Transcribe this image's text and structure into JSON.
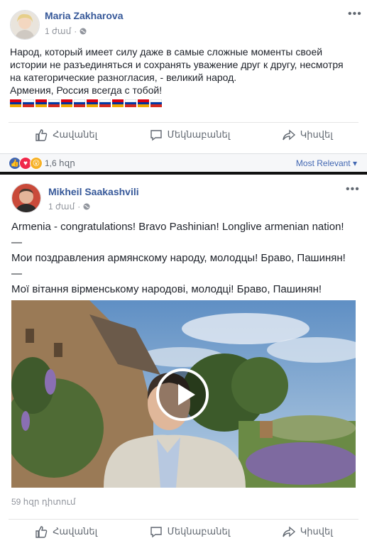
{
  "post1": {
    "author": "Maria Zakharova",
    "time": "1 ժամ",
    "more": "•••",
    "text_lines": [
      "Народ, который имеет силу даже в самые сложные моменты своей",
      "истории не разъединяться и сохранять уважение друг к другу, несмотря",
      "на категорические разногласия, - великий народ.",
      "Армения, Россия всегда с тобой!"
    ],
    "flags": [
      "armenia",
      "russia",
      "armenia",
      "russia",
      "armenia",
      "russia",
      "armenia",
      "russia",
      "armenia",
      "russia",
      "armenia",
      "russia"
    ],
    "actions": {
      "like": "Հավանել",
      "comment": "Մեկնաբանել",
      "share": "Կիսվել"
    },
    "reactions_count": "1,6 հզր",
    "sort_label": "Most Relevant"
  },
  "post2": {
    "author": "Mikheil Saakashvili",
    "time": "1 ժամ",
    "more": "•••",
    "text_lines": [
      "Armenia - congratulations! Bravo Pashinian! Longlive armenian nation!",
      "—",
      "Мои поздравления армянскому народу, молодцы! Браво, Пашинян!",
      "—",
      "Мої вітання вірменському народові, молодці! Браво, Пашинян!"
    ],
    "views": "59 հզր դիտում",
    "actions": {
      "like": "Հավանել",
      "comment": "Մեկնաբանել",
      "share": "Կիսվել"
    }
  },
  "colors": {
    "link": "#365899",
    "meta": "#90949c",
    "action": "#606770",
    "like_blue": "#4267b2",
    "love_red": "#f0284a",
    "wow_yellow": "#f7b125"
  }
}
